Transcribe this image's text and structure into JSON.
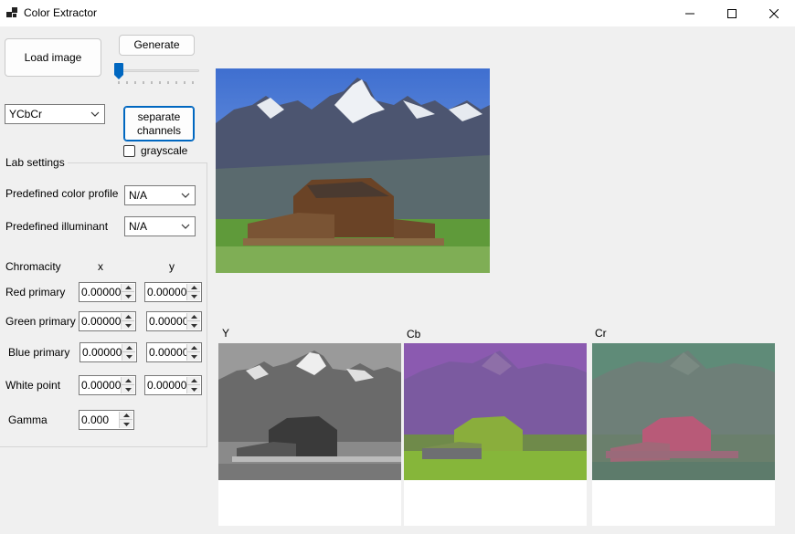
{
  "window": {
    "title": "Color Extractor"
  },
  "toolbar": {
    "load_image_label": "Load image",
    "generate_label": "Generate",
    "slider_value": 0
  },
  "colorspace": {
    "selected": "YCbCr",
    "separate_channels_label": "separate\nchannels",
    "grayscale_label": "grayscale",
    "grayscale_checked": false
  },
  "lab": {
    "group_title": "Lab settings",
    "color_profile_label": "Predefined color profile",
    "color_profile_value": "N/A",
    "illuminant_label": "Predefined illuminant",
    "illuminant_value": "N/A",
    "chromacity_label": "Chromacity",
    "x_header": "x",
    "y_header": "y",
    "rows": [
      {
        "label": "Red primary",
        "x": "0.00000",
        "y": "0.00000"
      },
      {
        "label": "Green primary",
        "x": "0.00000",
        "y": "0.00000"
      },
      {
        "label": "Blue primary",
        "x": "0.00000",
        "y": "0.00000"
      },
      {
        "label": "White point",
        "x": "0.00000",
        "y": "0.00000"
      }
    ],
    "gamma_label": "Gamma",
    "gamma_value": "0.000"
  },
  "channels": [
    {
      "label": "Y"
    },
    {
      "label": "Cb"
    },
    {
      "label": "Cr"
    }
  ],
  "colors": {
    "accent": "#0067c0",
    "window_bg": "#f0f0f0"
  }
}
